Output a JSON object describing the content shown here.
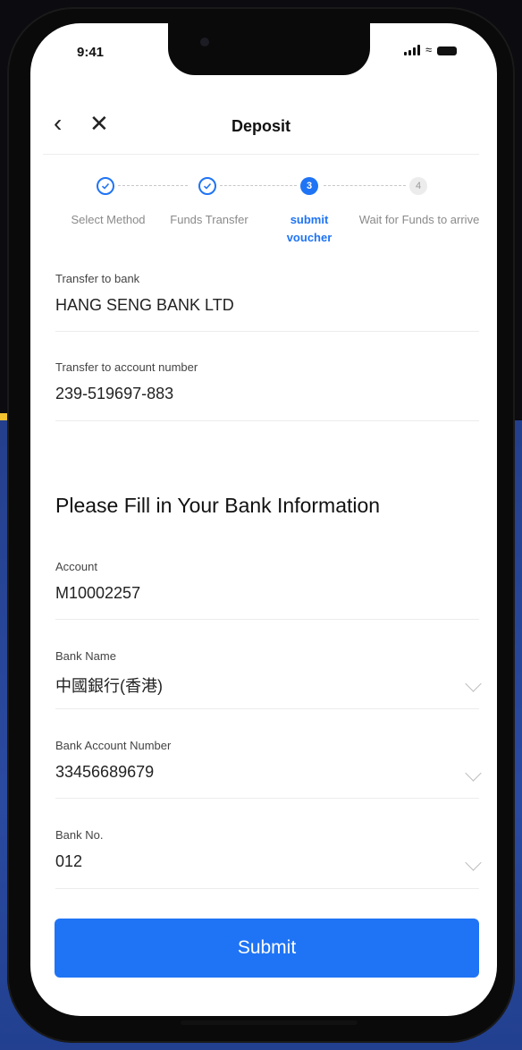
{
  "status_bar": {
    "time": "9:41"
  },
  "nav": {
    "title": "Deposit"
  },
  "steps": [
    {
      "label": "Select Method",
      "state": "done"
    },
    {
      "label": "Funds Transfer",
      "state": "done"
    },
    {
      "label": "submit voucher",
      "number": "3",
      "state": "active"
    },
    {
      "label": "Wait for Funds to arrive",
      "number": "4",
      "state": "pending"
    }
  ],
  "transfer": {
    "bank_label": "Transfer to bank",
    "bank_value": "HANG SENG BANK LTD",
    "account_label": "Transfer to account number",
    "account_value": "239-519697-883"
  },
  "form": {
    "section_title": "Please Fill in Your Bank Information",
    "account_label": "Account",
    "account_value": "M10002257",
    "bank_name_label": "Bank Name",
    "bank_name_value": "中國銀行(香港)",
    "bank_account_number_label": "Bank Account Number",
    "bank_account_number_value": "33456689679",
    "bank_no_label": "Bank No.",
    "bank_no_value": "012"
  },
  "submit_label": "Submit",
  "colors": {
    "accent": "#1f74f5",
    "background_blue": "#2a4aa0"
  }
}
